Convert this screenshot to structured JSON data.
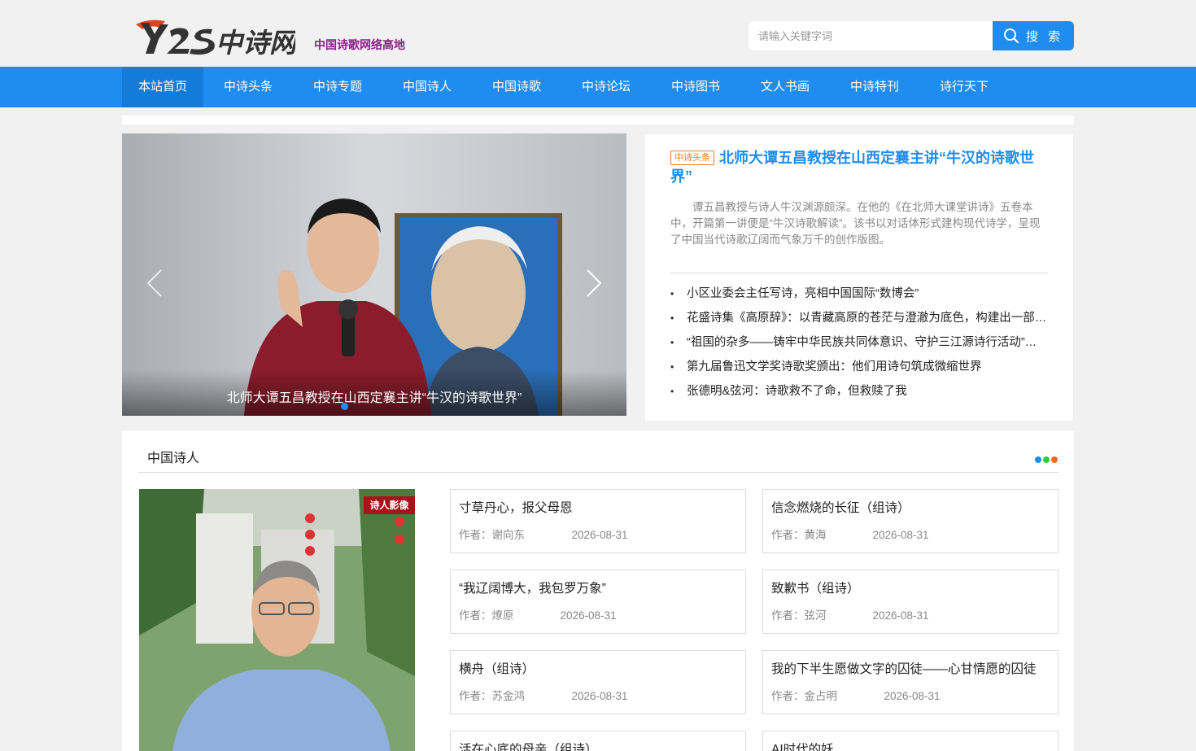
{
  "header": {
    "logo_text": "Y2S中诗网",
    "slogan": "中国诗歌网络高地",
    "search_placeholder": "请输入关键字词",
    "search_button": "搜 索"
  },
  "nav": {
    "items": [
      {
        "label": "本站首页",
        "active": true
      },
      {
        "label": "中诗头条"
      },
      {
        "label": "中诗专题"
      },
      {
        "label": "中国诗人"
      },
      {
        "label": "中国诗歌"
      },
      {
        "label": "中诗论坛"
      },
      {
        "label": "中诗图书"
      },
      {
        "label": "文人书画"
      },
      {
        "label": "中诗特刊"
      },
      {
        "label": "诗行天下"
      }
    ]
  },
  "slider": {
    "caption": "北师大谭五昌教授在山西定襄主讲“牛汉的诗歌世界”"
  },
  "headline": {
    "tag": "中诗头条",
    "title": "北师大谭五昌教授在山西定襄主讲“牛汉的诗歌世界”",
    "summary": "谭五昌教授与诗人牛汉渊源颇深。在他的《在北师大课堂讲诗》五卷本中，开篇第一讲便是“牛汉诗歌解读”。该书以对话体形式建构现代诗学，呈现了中国当代诗歌辽阔而气象万千的创作版图。",
    "list": [
      "小区业委会主任写诗，亮相中国国际“数博会”",
      "花盛诗集《高原辞》：以青藏高原的苍茫与澄澈为底色，构建出一部融合地域书写、生命哲思与民族情感的诗性史诗",
      "“祖国的杂多——铸牢中华民族共同体意识、守护三江源诗行活动”启动",
      "第九届鲁迅文学奖诗歌奖颁出：他们用诗句筑成微缩世界",
      "张德明&弦河：诗歌救不了命，但救赎了我"
    ]
  },
  "poets": {
    "title": "中国诗人",
    "photo_badge": "诗人影像",
    "author_prefix": "作者：",
    "cards": [
      {
        "title": "寸草丹心，报父母恩",
        "author": "谢向东",
        "date": "2026-08-31"
      },
      {
        "title": "信念燃烧的长征（组诗）",
        "author": "黄海",
        "date": "2026-08-31"
      },
      {
        "title": "“我辽阔博大，我包罗万象”",
        "author": "燎原",
        "date": "2026-08-31"
      },
      {
        "title": "致歉书（组诗）",
        "author": "弦河",
        "date": "2026-08-31"
      },
      {
        "title": "横舟（组诗）",
        "author": "苏金鸿",
        "date": "2026-08-31"
      },
      {
        "title": "我的下半生愿做文字的囚徒——心甘情愿的囚徒",
        "author": "金占明",
        "date": "2026-08-31"
      },
      {
        "title": "活在心底的母亲（组诗）",
        "author": "",
        "date": ""
      },
      {
        "title": "AI时代的妖",
        "author": "",
        "date": ""
      }
    ]
  },
  "colors": {
    "brand_blue": "#1e8cf0",
    "nav_active": "#137bd9",
    "tag_orange": "#e67e22",
    "badge_red": "#a8131b",
    "dot_blue": "#1e8cf0",
    "dot_green": "#2ecc40",
    "dot_orange": "#f06a1e"
  }
}
